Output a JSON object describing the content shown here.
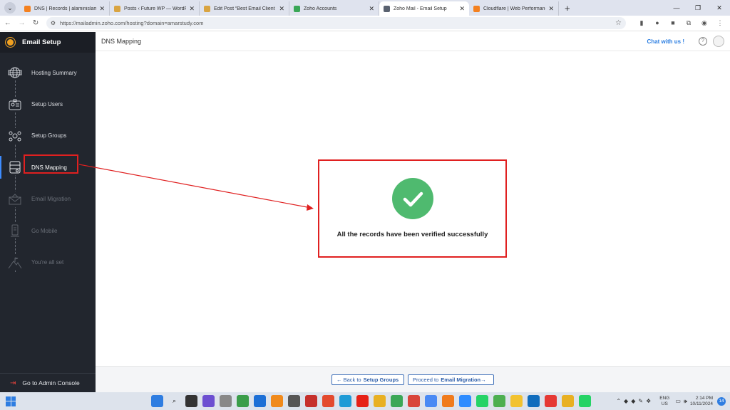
{
  "browser": {
    "tabs": [
      {
        "title": "DNS | Records | alaminislam.m",
        "favicon_color": "#f48120"
      },
      {
        "title": "Posts ‹ Future WP — WordPress",
        "favicon_color": "#d9a441"
      },
      {
        "title": "Edit Post “Best Email Client For",
        "favicon_color": "#d9a441"
      },
      {
        "title": "Zoho Accounts",
        "favicon_color": "#3aa757"
      },
      {
        "title": "Zoho Mail - Email Setup",
        "favicon_color": "#5a6270"
      },
      {
        "title": "Cloudflare | Web Performance &",
        "favicon_color": "#f48120"
      }
    ],
    "active_tab_index": 4,
    "url": "https://mailadmin.zoho.com/hosting?domain=amarstudy.com"
  },
  "sidebar": {
    "title": "Email Setup",
    "steps": [
      {
        "label": "Hosting Summary",
        "icon": "globe-icon",
        "state": "done"
      },
      {
        "label": "Setup Users",
        "icon": "user-card-icon",
        "state": "done"
      },
      {
        "label": "Setup Groups",
        "icon": "group-icon",
        "state": "done"
      },
      {
        "label": "DNS Mapping",
        "icon": "server-icon",
        "state": "active"
      },
      {
        "label": "Email Migration",
        "icon": "envelope-icon",
        "state": "disabled"
      },
      {
        "label": "Go Mobile",
        "icon": "mobile-icon",
        "state": "disabled"
      },
      {
        "label": "You're all set",
        "icon": "mountain-flag-icon",
        "state": "disabled"
      }
    ],
    "footer": "Go to Admin Console"
  },
  "header": {
    "title": "DNS Mapping",
    "chat": "Chat with us !"
  },
  "main": {
    "message": "All the records have been verified successfully"
  },
  "footer": {
    "back_prefix": "Back to",
    "back_target": "Setup Groups",
    "next_prefix": "Proceed to",
    "next_target": "Email Migration"
  },
  "taskbar": {
    "lang_top": "ENG",
    "lang_bottom": "US",
    "time": "2:14 PM",
    "date": "10/11/2024",
    "notifications": "14"
  },
  "colors": {
    "sidebar_bg": "#22262e",
    "accent": "#2a7de1",
    "success": "#4fba6f",
    "annotation_red": "#e02020"
  }
}
